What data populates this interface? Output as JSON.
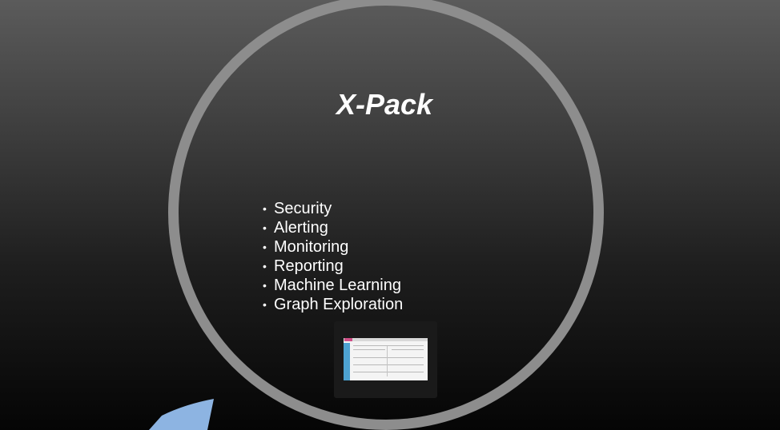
{
  "slide": {
    "title": "X-Pack",
    "bullet_symbol": "•",
    "items": [
      "Security",
      "Alerting",
      "Monitoring",
      "Reporting",
      "Machine Learning",
      "Graph Exploration"
    ]
  },
  "colors": {
    "ring": "#8d8d8d",
    "text": "#ffffff",
    "shard": "#8db4e2",
    "thumb_sidebar": "#4da2d1",
    "thumb_accent": "#d04f87"
  }
}
